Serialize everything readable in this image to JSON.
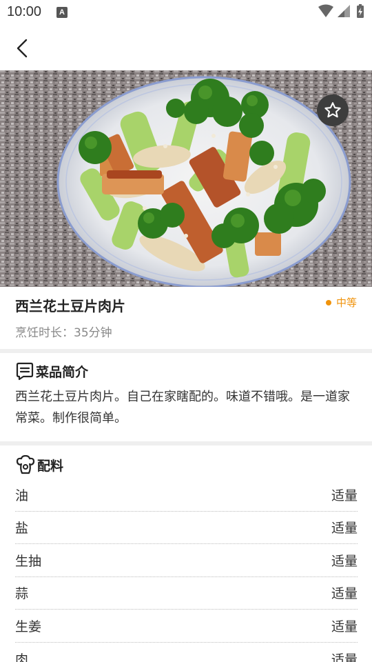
{
  "status_bar": {
    "time": "10:00",
    "notification_badge": "A"
  },
  "recipe": {
    "title": "西兰花土豆片肉片",
    "difficulty": "中等",
    "cook_time": "烹饪时长：35分钟",
    "colors": {
      "accent": "#f0930c"
    }
  },
  "intro": {
    "heading": "菜品简介",
    "text": "西兰花土豆片肉片。自己在家瞎配的。味道不错哦。是一道家常菜。制作很简单。"
  },
  "ingredients": {
    "heading": "配料",
    "items": [
      {
        "name": "油",
        "amount": "适量"
      },
      {
        "name": "盐",
        "amount": "适量"
      },
      {
        "name": "生抽",
        "amount": "适量"
      },
      {
        "name": "蒜",
        "amount": "适量"
      },
      {
        "name": "生姜",
        "amount": "适量"
      },
      {
        "name": "肉",
        "amount": "适量"
      }
    ]
  },
  "icons": [
    "back-arrow-icon",
    "star-icon",
    "wifi-icon",
    "signal-icon",
    "battery-icon",
    "comment-icon",
    "ingredients-icon"
  ]
}
